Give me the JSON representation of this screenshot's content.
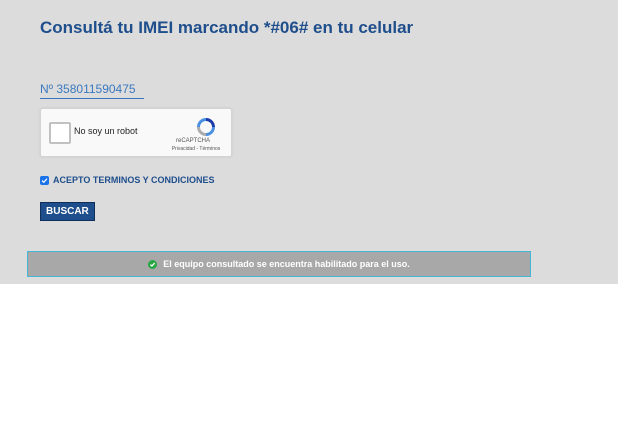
{
  "page": {
    "title": "Consultá tu IMEI marcando *#06# en tu celular"
  },
  "imei": {
    "value": "Nº 358011590475"
  },
  "captcha": {
    "label": "No soy un robot",
    "brand": "reCAPTCHA",
    "links": "Privacidad - Términos",
    "checked": false
  },
  "terms": {
    "label": "ACEPTO TERMINOS Y CONDICIONES",
    "checked": true
  },
  "buttons": {
    "search_label": "BUSCAR"
  },
  "status": {
    "message": "El equipo consultado se encuentra habilitado para el uso.",
    "type": "success"
  },
  "colors": {
    "title": "#1f4e8c",
    "panel_background": "#dcdcdc",
    "success": "#28a745",
    "status_background": "#a8a8a8",
    "status_border": "#47b6d4"
  },
  "icons": {
    "status": "check-circle-icon",
    "terms": "checkbox-checked-icon",
    "captcha": "recaptcha-logo-icon"
  }
}
